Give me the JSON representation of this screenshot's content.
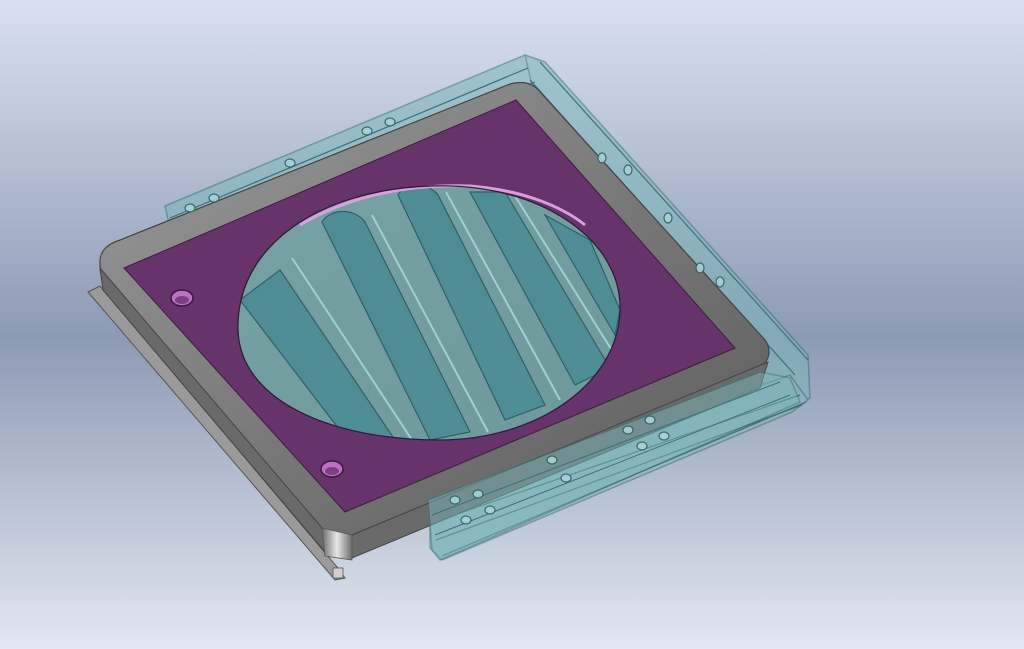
{
  "viewport": {
    "name": "3d-model-viewport",
    "background_top": "#d9e1f1",
    "background_mid": "#8c9ab3",
    "background_bottom": "#e3e8f2"
  },
  "model": {
    "name": "fan-grille-plate-assembly",
    "colors": {
      "plate_face": "#66336a",
      "plate_rim_light": "#8a8a8a",
      "plate_rim_dark": "#5e5e5e",
      "plate_edge": "#6f6f6f",
      "transparent_body": "#7ab6b8",
      "transparent_edge": "#3f6f76",
      "hole_fill": "#c06fc6"
    },
    "slot_count": 5,
    "mount_hole_count": 2
  }
}
